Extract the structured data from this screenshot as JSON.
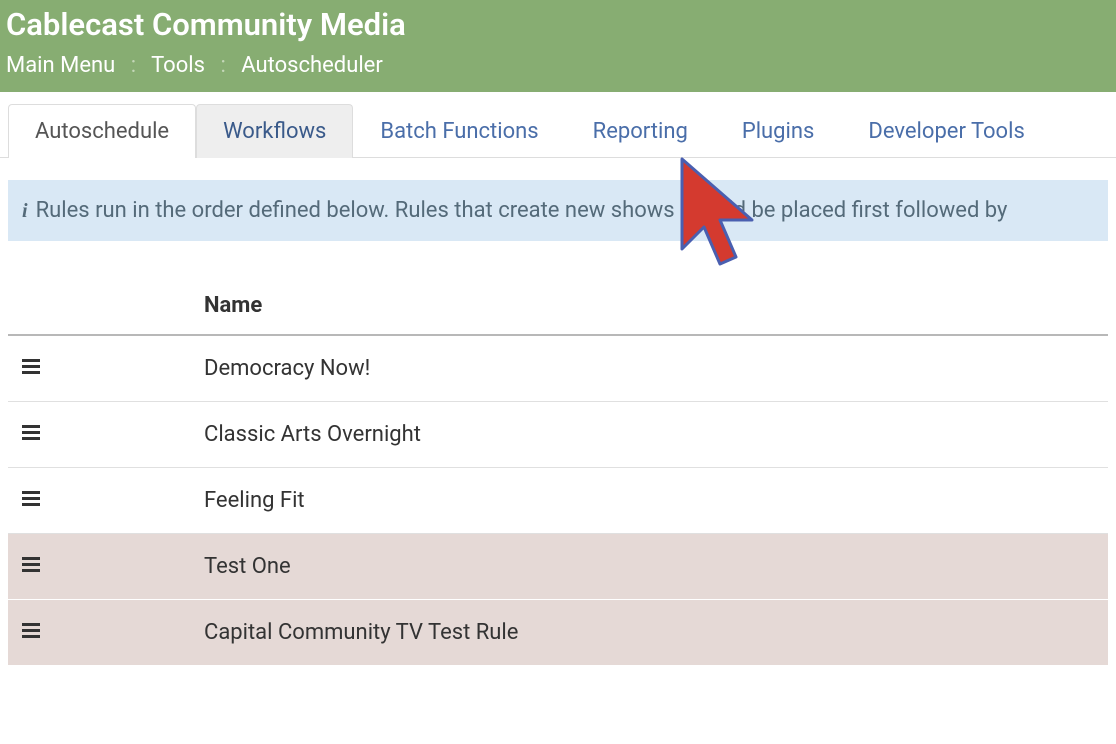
{
  "header": {
    "title": "Cablecast Community Media",
    "breadcrumb": [
      "Main Menu",
      "Tools",
      "Autoscheduler"
    ]
  },
  "tabs": [
    {
      "label": "Autoschedule",
      "active": true
    },
    {
      "label": "Workflows",
      "hover": true
    },
    {
      "label": "Batch Functions"
    },
    {
      "label": "Reporting"
    },
    {
      "label": "Plugins"
    },
    {
      "label": "Developer Tools"
    }
  ],
  "info_banner": "Rules run in the order defined below. Rules that create new shows should be placed first followed by",
  "table": {
    "header": {
      "name": "Name"
    },
    "rows": [
      {
        "name": "Democracy Now!",
        "shaded": false
      },
      {
        "name": "Classic Arts Overnight",
        "shaded": false
      },
      {
        "name": "Feeling Fit",
        "shaded": false
      },
      {
        "name": "Test One",
        "shaded": true
      },
      {
        "name": "Capital Community TV Test Rule",
        "shaded": true
      }
    ]
  }
}
